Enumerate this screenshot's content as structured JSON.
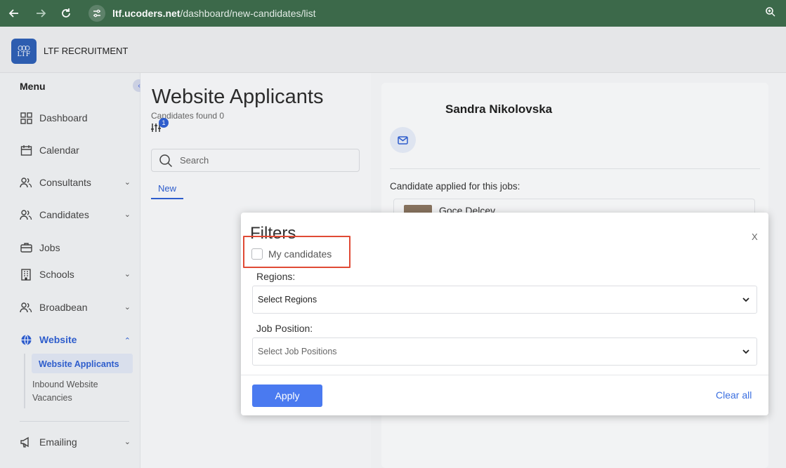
{
  "browser": {
    "url_host": "ltf.ucoders.net",
    "url_path": "/dashboard/new-candidates/list"
  },
  "app": {
    "brand": "LTF RECRUITMENT",
    "logo_text": "LTF"
  },
  "sidebar": {
    "menu_title": "Menu",
    "items": [
      {
        "label": "Dashboard",
        "icon": "grid-icon"
      },
      {
        "label": "Calendar",
        "icon": "calendar-icon"
      },
      {
        "label": "Consultants",
        "icon": "users-icon"
      },
      {
        "label": "Candidates",
        "icon": "users-icon"
      },
      {
        "label": "Jobs",
        "icon": "briefcase-icon"
      },
      {
        "label": "Schools",
        "icon": "building-icon"
      },
      {
        "label": "Broadbean",
        "icon": "users-icon"
      },
      {
        "label": "Website",
        "icon": "globe-icon"
      },
      {
        "label": "Emailing",
        "icon": "megaphone-icon"
      }
    ],
    "website_sub": [
      "Website Applicants",
      "Inbound Website Vacancies"
    ]
  },
  "list": {
    "title": "Website Applicants",
    "candidates_found": "Candidates found 0",
    "filter_badge": "1",
    "search_placeholder": "Search",
    "tab_new": "New"
  },
  "detail": {
    "candidate_name": "Sandra Nikolovska",
    "applied_label": "Candidate applied for this jobs:",
    "job_title": "Goce Delcev"
  },
  "filters_modal": {
    "title": "Filters",
    "close": "X",
    "my_candidates_label": "My candidates",
    "my_candidates_checked": false,
    "regions_label": "Regions:",
    "regions_placeholder": "Select Regions",
    "job_position_label": "Job Position:",
    "job_position_placeholder": "Select Job Positions",
    "apply_label": "Apply",
    "clear_all_label": "Clear all"
  },
  "colors": {
    "browser_bar": "#3d6b4c",
    "accent": "#2f5fd0",
    "apply_button": "#4a7af0",
    "highlight": "#e04a35"
  }
}
